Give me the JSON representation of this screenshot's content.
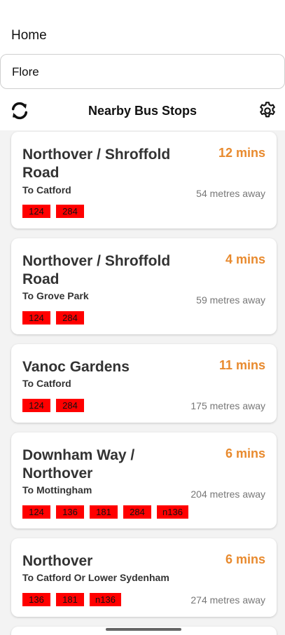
{
  "header": {
    "home_label": "Home"
  },
  "search": {
    "value": "Flore"
  },
  "toolbar": {
    "title": "Nearby Bus Stops",
    "refresh_icon": "refresh-icon",
    "settings_icon": "gear-icon"
  },
  "stops": [
    {
      "name": "Northover / Shroffold Road",
      "direction": "To Catford",
      "eta": "12 mins",
      "distance": "54  metres away",
      "routes": [
        "124",
        "284"
      ]
    },
    {
      "name": "Northover / Shroffold Road",
      "direction": "To Grove Park",
      "eta": "4 mins",
      "distance": "59  metres away",
      "routes": [
        "124",
        "284"
      ]
    },
    {
      "name": "Vanoc Gardens",
      "direction": "To Catford",
      "eta": "11 mins",
      "distance": "175  metres away",
      "routes": [
        "124",
        "284"
      ]
    },
    {
      "name": "Downham Way / Northover",
      "direction": "To Mottingham",
      "eta": "6 mins",
      "distance": "204  metres away",
      "routes": [
        "124",
        "136",
        "181",
        "284",
        "n136"
      ]
    },
    {
      "name": "Northover",
      "direction": "To Catford Or Lower Sydenham",
      "eta": "6 mins",
      "distance": "274  metres away",
      "routes": [
        "136",
        "181",
        "n136"
      ]
    }
  ],
  "colors": {
    "eta": "#e88a2e",
    "route_badge": "#ff0000"
  }
}
